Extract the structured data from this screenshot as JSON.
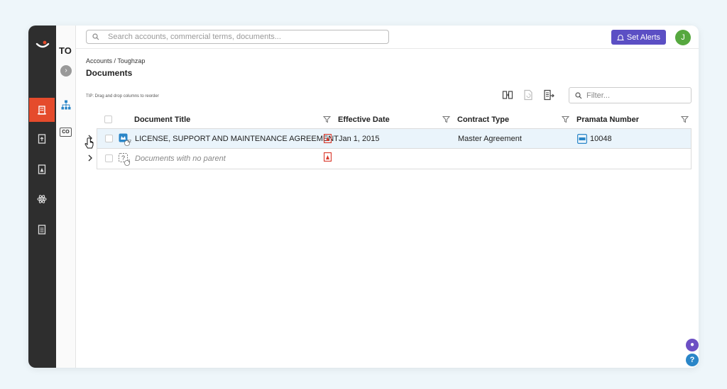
{
  "search": {
    "placeholder": "Search accounts, commercial terms, documents..."
  },
  "header": {
    "alerts_label": "Set Alerts",
    "avatar_initial": "J"
  },
  "subnav": {
    "short_title": "TO",
    "co_badge": "CO"
  },
  "breadcrumb": "Accounts / Toughzap",
  "page_title": "Documents",
  "tip": "TIP: Drag and drop columns to reorder",
  "filter": {
    "placeholder": "Filter..."
  },
  "columns": [
    "Document Title",
    "Effective Date",
    "Contract Type",
    "Pramata Number"
  ],
  "rows": [
    {
      "title": "LICENSE, SUPPORT AND MAINTENANCE AGREEMENT",
      "child_count": "12",
      "effective_date": "Jan 1, 2015",
      "contract_type": "Master Agreement",
      "pramata_number": "10048"
    },
    {
      "title": "Documents with no parent",
      "child_count": "1",
      "effective_date": "",
      "contract_type": "",
      "pramata_number": ""
    }
  ],
  "colors": {
    "rail": "#2e2e2e",
    "accent_orange": "#e54b2c",
    "alerts": "#5b4fc4",
    "avatar": "#56a83f",
    "selected_row": "#eaf4fb"
  }
}
